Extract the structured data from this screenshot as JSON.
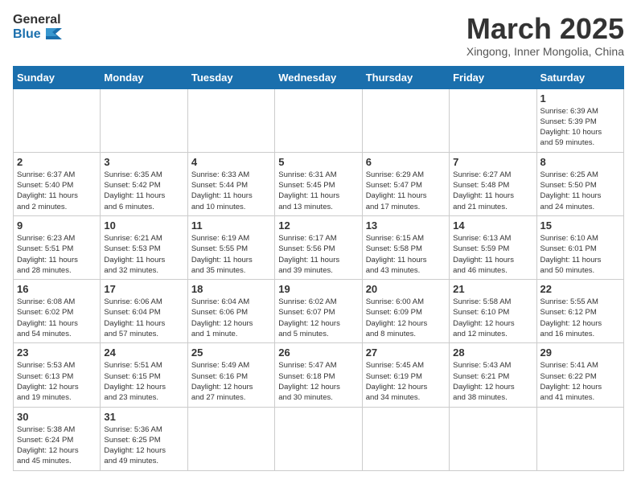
{
  "header": {
    "logo_general": "General",
    "logo_blue": "Blue",
    "month_title": "March 2025",
    "subtitle": "Xingong, Inner Mongolia, China"
  },
  "days_of_week": [
    "Sunday",
    "Monday",
    "Tuesday",
    "Wednesday",
    "Thursday",
    "Friday",
    "Saturday"
  ],
  "weeks": [
    [
      {
        "day": "",
        "info": ""
      },
      {
        "day": "",
        "info": ""
      },
      {
        "day": "",
        "info": ""
      },
      {
        "day": "",
        "info": ""
      },
      {
        "day": "",
        "info": ""
      },
      {
        "day": "",
        "info": ""
      },
      {
        "day": "1",
        "info": "Sunrise: 6:39 AM\nSunset: 5:39 PM\nDaylight: 10 hours\nand 59 minutes."
      }
    ],
    [
      {
        "day": "2",
        "info": "Sunrise: 6:37 AM\nSunset: 5:40 PM\nDaylight: 11 hours\nand 2 minutes."
      },
      {
        "day": "3",
        "info": "Sunrise: 6:35 AM\nSunset: 5:42 PM\nDaylight: 11 hours\nand 6 minutes."
      },
      {
        "day": "4",
        "info": "Sunrise: 6:33 AM\nSunset: 5:44 PM\nDaylight: 11 hours\nand 10 minutes."
      },
      {
        "day": "5",
        "info": "Sunrise: 6:31 AM\nSunset: 5:45 PM\nDaylight: 11 hours\nand 13 minutes."
      },
      {
        "day": "6",
        "info": "Sunrise: 6:29 AM\nSunset: 5:47 PM\nDaylight: 11 hours\nand 17 minutes."
      },
      {
        "day": "7",
        "info": "Sunrise: 6:27 AM\nSunset: 5:48 PM\nDaylight: 11 hours\nand 21 minutes."
      },
      {
        "day": "8",
        "info": "Sunrise: 6:25 AM\nSunset: 5:50 PM\nDaylight: 11 hours\nand 24 minutes."
      }
    ],
    [
      {
        "day": "9",
        "info": "Sunrise: 6:23 AM\nSunset: 5:51 PM\nDaylight: 11 hours\nand 28 minutes."
      },
      {
        "day": "10",
        "info": "Sunrise: 6:21 AM\nSunset: 5:53 PM\nDaylight: 11 hours\nand 32 minutes."
      },
      {
        "day": "11",
        "info": "Sunrise: 6:19 AM\nSunset: 5:55 PM\nDaylight: 11 hours\nand 35 minutes."
      },
      {
        "day": "12",
        "info": "Sunrise: 6:17 AM\nSunset: 5:56 PM\nDaylight: 11 hours\nand 39 minutes."
      },
      {
        "day": "13",
        "info": "Sunrise: 6:15 AM\nSunset: 5:58 PM\nDaylight: 11 hours\nand 43 minutes."
      },
      {
        "day": "14",
        "info": "Sunrise: 6:13 AM\nSunset: 5:59 PM\nDaylight: 11 hours\nand 46 minutes."
      },
      {
        "day": "15",
        "info": "Sunrise: 6:10 AM\nSunset: 6:01 PM\nDaylight: 11 hours\nand 50 minutes."
      }
    ],
    [
      {
        "day": "16",
        "info": "Sunrise: 6:08 AM\nSunset: 6:02 PM\nDaylight: 11 hours\nand 54 minutes."
      },
      {
        "day": "17",
        "info": "Sunrise: 6:06 AM\nSunset: 6:04 PM\nDaylight: 11 hours\nand 57 minutes."
      },
      {
        "day": "18",
        "info": "Sunrise: 6:04 AM\nSunset: 6:06 PM\nDaylight: 12 hours\nand 1 minute."
      },
      {
        "day": "19",
        "info": "Sunrise: 6:02 AM\nSunset: 6:07 PM\nDaylight: 12 hours\nand 5 minutes."
      },
      {
        "day": "20",
        "info": "Sunrise: 6:00 AM\nSunset: 6:09 PM\nDaylight: 12 hours\nand 8 minutes."
      },
      {
        "day": "21",
        "info": "Sunrise: 5:58 AM\nSunset: 6:10 PM\nDaylight: 12 hours\nand 12 minutes."
      },
      {
        "day": "22",
        "info": "Sunrise: 5:55 AM\nSunset: 6:12 PM\nDaylight: 12 hours\nand 16 minutes."
      }
    ],
    [
      {
        "day": "23",
        "info": "Sunrise: 5:53 AM\nSunset: 6:13 PM\nDaylight: 12 hours\nand 19 minutes."
      },
      {
        "day": "24",
        "info": "Sunrise: 5:51 AM\nSunset: 6:15 PM\nDaylight: 12 hours\nand 23 minutes."
      },
      {
        "day": "25",
        "info": "Sunrise: 5:49 AM\nSunset: 6:16 PM\nDaylight: 12 hours\nand 27 minutes."
      },
      {
        "day": "26",
        "info": "Sunrise: 5:47 AM\nSunset: 6:18 PM\nDaylight: 12 hours\nand 30 minutes."
      },
      {
        "day": "27",
        "info": "Sunrise: 5:45 AM\nSunset: 6:19 PM\nDaylight: 12 hours\nand 34 minutes."
      },
      {
        "day": "28",
        "info": "Sunrise: 5:43 AM\nSunset: 6:21 PM\nDaylight: 12 hours\nand 38 minutes."
      },
      {
        "day": "29",
        "info": "Sunrise: 5:41 AM\nSunset: 6:22 PM\nDaylight: 12 hours\nand 41 minutes."
      }
    ],
    [
      {
        "day": "30",
        "info": "Sunrise: 5:38 AM\nSunset: 6:24 PM\nDaylight: 12 hours\nand 45 minutes."
      },
      {
        "day": "31",
        "info": "Sunrise: 5:36 AM\nSunset: 6:25 PM\nDaylight: 12 hours\nand 49 minutes."
      },
      {
        "day": "",
        "info": ""
      },
      {
        "day": "",
        "info": ""
      },
      {
        "day": "",
        "info": ""
      },
      {
        "day": "",
        "info": ""
      },
      {
        "day": "",
        "info": ""
      }
    ]
  ]
}
